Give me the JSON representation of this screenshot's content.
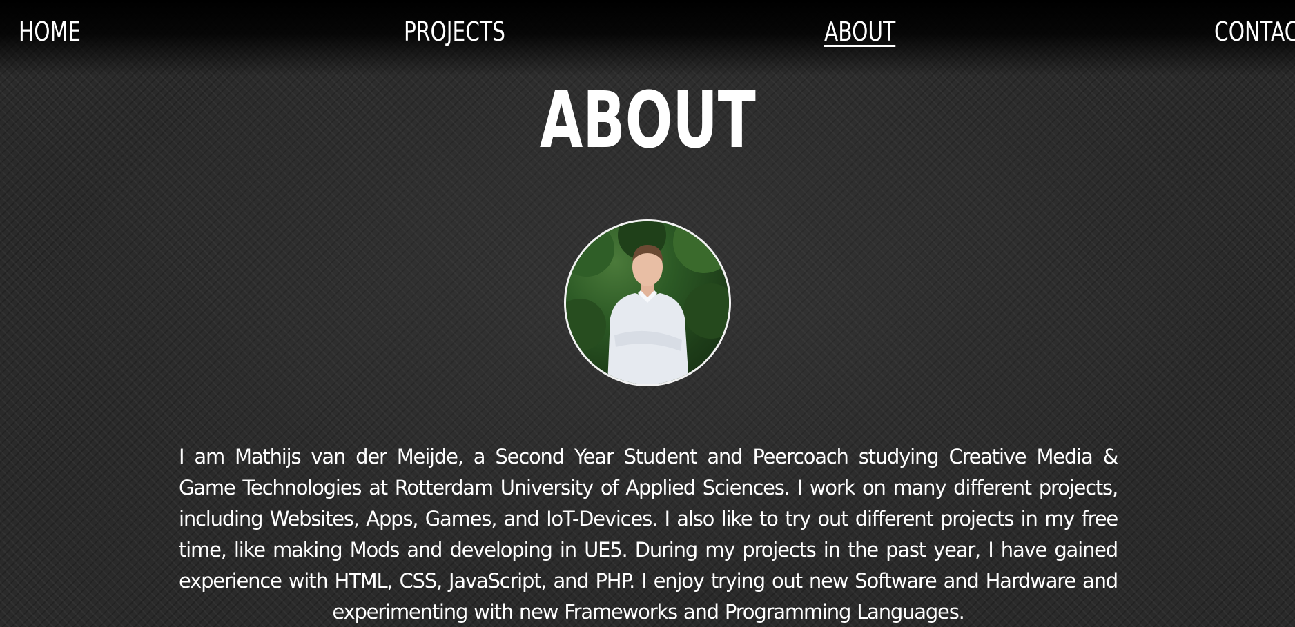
{
  "nav": {
    "home": "HOME",
    "projects": "PROJECTS",
    "about": "ABOUT",
    "contact": "CONTACT"
  },
  "page": {
    "title": "ABOUT",
    "bio": "I am Mathijs van der Meijde, a Second Year Student and Peercoach studying Creative Media & Game Technologies at Rotterdam University of Applied Sciences. I work on many different projects, including Websites, Apps, Games, and IoT-Devices. I also like to try out different projects in my free time, like making Mods and developing in UE5. During my projects in the past year, I have gained experience with HTML, CSS, JavaScript, and PHP. I enjoy trying out new Software and Hardware and experimenting with new Frameworks and Programming Languages."
  },
  "colors": {
    "text": "#ffffff",
    "background": "#2a2a2a",
    "avatar_border": "#f2f2f2"
  }
}
